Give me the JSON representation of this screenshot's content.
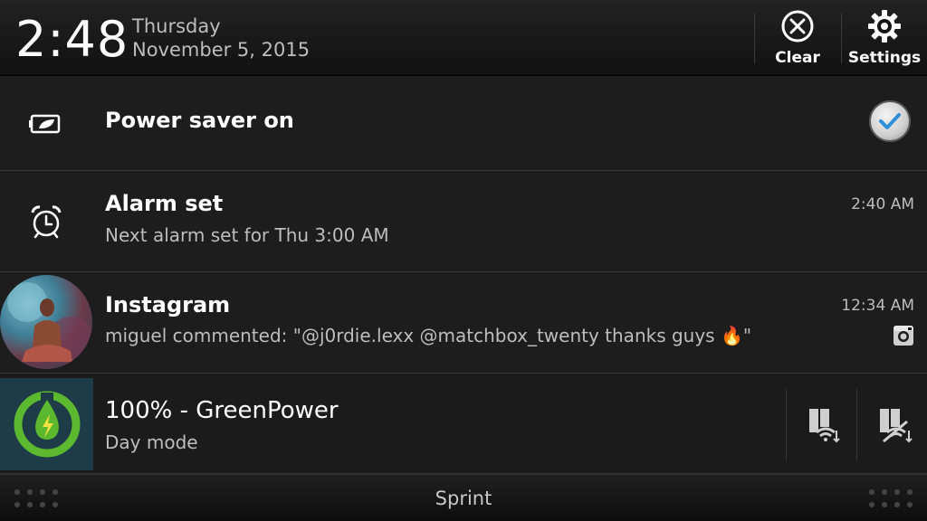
{
  "header": {
    "time": "2:48",
    "day": "Thursday",
    "date": "November 5, 2015",
    "clear_label": "Clear",
    "settings_label": "Settings"
  },
  "notifications": [
    {
      "title": "Power saver on",
      "checked": true
    },
    {
      "title": "Alarm set",
      "text": "Next alarm set for Thu 3:00 AM",
      "time": "2:40 AM"
    },
    {
      "title": "Instagram",
      "text": "miguel commented: \"@j0rdie.lexx @matchbox_twenty thanks guys 🔥\"",
      "time": "12:34 AM"
    },
    {
      "title": "100% - GreenPower",
      "text": "Day mode"
    }
  ],
  "footer": {
    "carrier": "Sprint"
  },
  "colors": {
    "accent_check": "#2f8fd8",
    "greenpower_green": "#5cb82f"
  }
}
